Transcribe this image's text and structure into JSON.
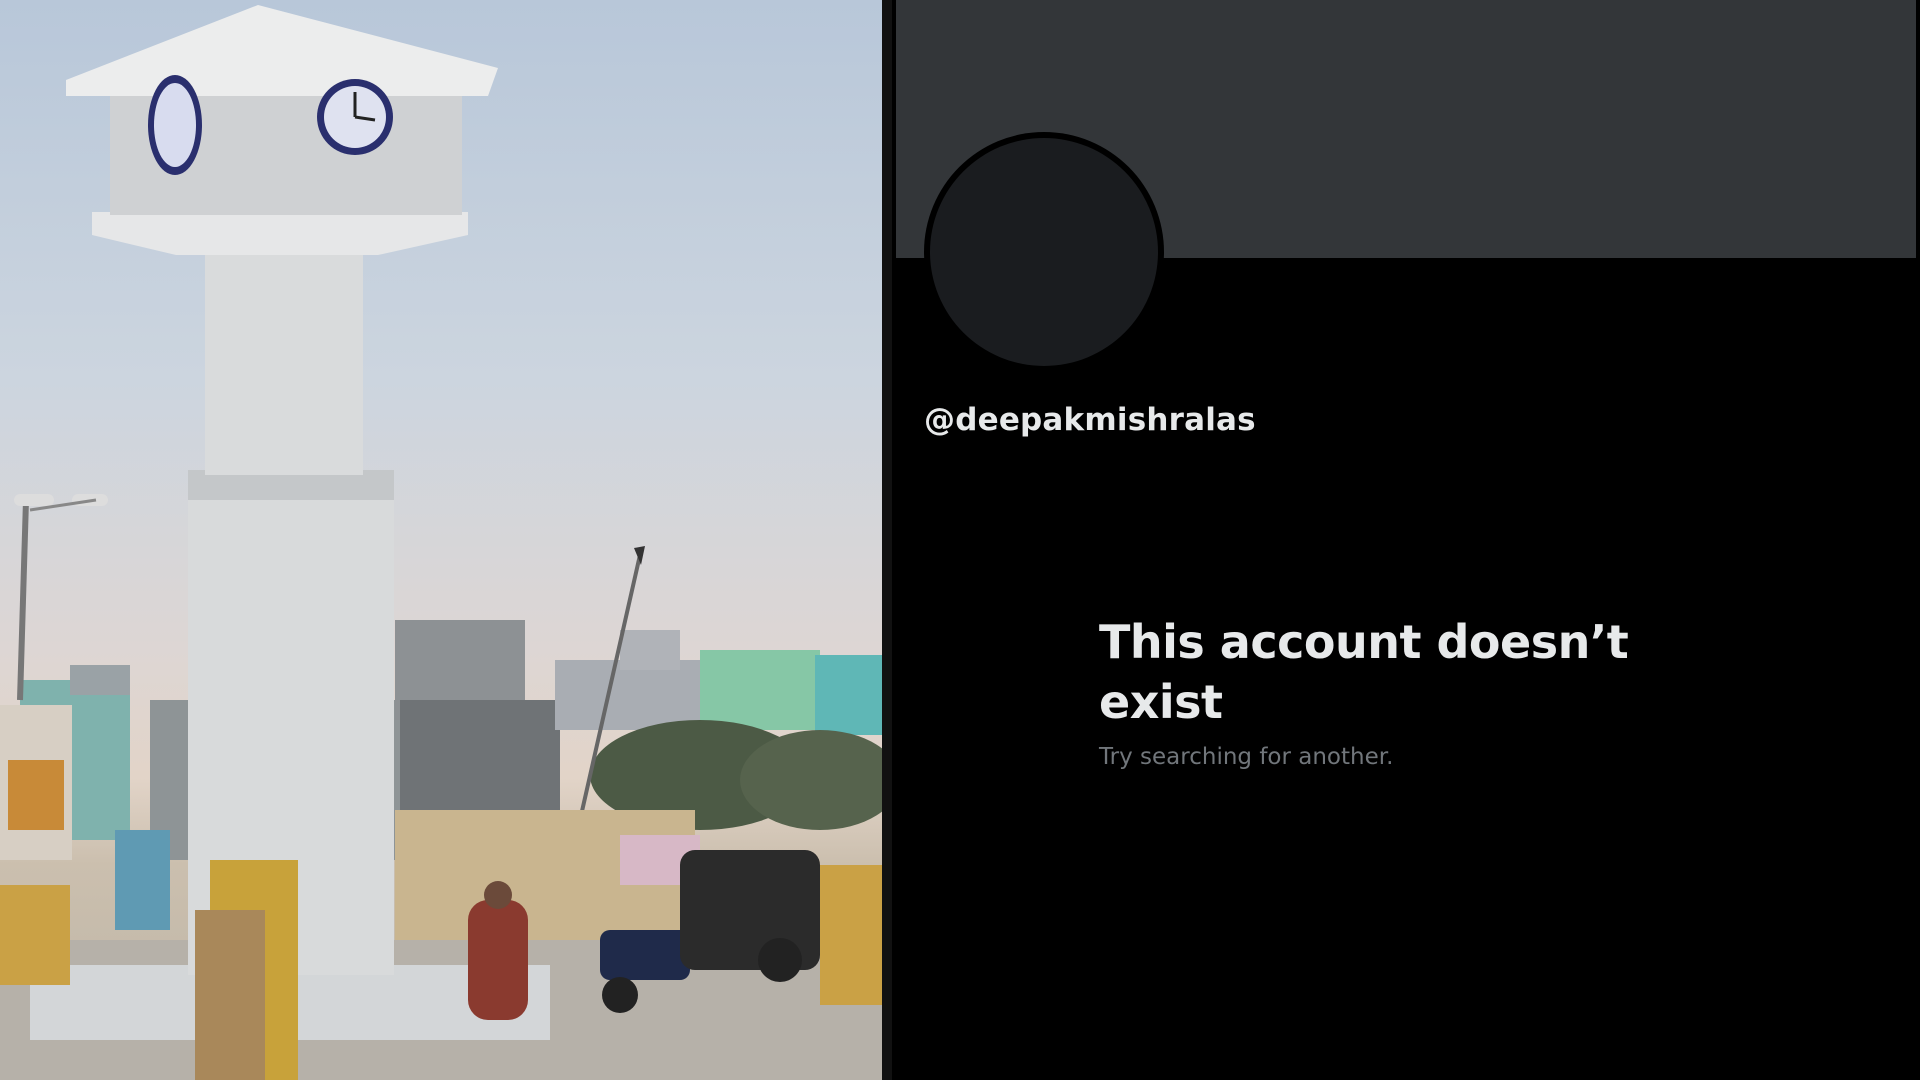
{
  "photo": {
    "subject": "clock-tower",
    "colors": {
      "sky_top": "#b8c7d9",
      "sky_horizon": "#e2d4c8",
      "tower": "#d9dbdc",
      "clock_face": "#2a2f6e"
    }
  },
  "profile": {
    "handle": "@deepakmishralas",
    "empty_state": {
      "title": "This account doesn’t exist",
      "subtitle": "Try searching for another."
    },
    "colors": {
      "banner": "#333639",
      "avatar": "#1a1c1f",
      "background": "#000000",
      "primary_text": "#e7e9ea",
      "secondary_text": "#71767b"
    }
  }
}
